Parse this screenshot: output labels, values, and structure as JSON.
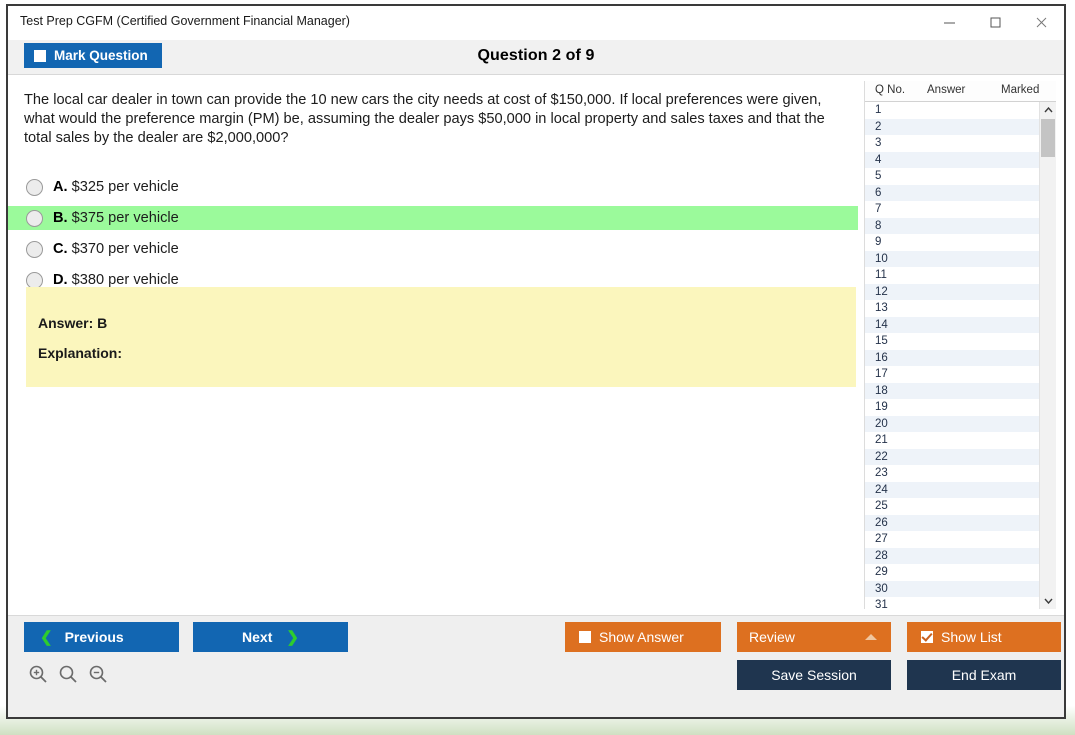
{
  "window": {
    "title": "Test Prep CGFM (Certified Government Financial Manager)",
    "minimize_label": "minimize",
    "maximize_label": "maximize",
    "close_label": "close"
  },
  "header": {
    "mark_question_label": "Mark Question",
    "mark_question_checked": false,
    "question_title": "Question 2 of 9"
  },
  "question": {
    "text": "The local car dealer in town can provide the 10 new cars the city needs at cost of $150,000. If local preferences were given, what would the preference margin (PM) be, assuming the dealer pays $50,000 in local property and sales taxes and that the total sales by the dealer are $2,000,000?",
    "options": [
      {
        "letter": "A.",
        "text": "$325 per vehicle",
        "selected": false,
        "highlighted": false
      },
      {
        "letter": "B.",
        "text": "$375 per vehicle",
        "selected": false,
        "highlighted": true
      },
      {
        "letter": "C.",
        "text": "$370 per vehicle",
        "selected": false,
        "highlighted": false
      },
      {
        "letter": "D.",
        "text": "$380 per vehicle",
        "selected": false,
        "highlighted": false
      }
    ]
  },
  "answer_panel": {
    "answer_label": "Answer: B",
    "explanation_label": "Explanation:"
  },
  "question_list": {
    "columns": [
      "Q No.",
      "Answer",
      "Marked"
    ],
    "rows": [
      {
        "no": "1",
        "answer": "",
        "marked": ""
      },
      {
        "no": "2",
        "answer": "",
        "marked": ""
      },
      {
        "no": "3",
        "answer": "",
        "marked": ""
      },
      {
        "no": "4",
        "answer": "",
        "marked": ""
      },
      {
        "no": "5",
        "answer": "",
        "marked": ""
      },
      {
        "no": "6",
        "answer": "",
        "marked": ""
      },
      {
        "no": "7",
        "answer": "",
        "marked": ""
      },
      {
        "no": "8",
        "answer": "",
        "marked": ""
      },
      {
        "no": "9",
        "answer": "",
        "marked": ""
      },
      {
        "no": "10",
        "answer": "",
        "marked": ""
      },
      {
        "no": "11",
        "answer": "",
        "marked": ""
      },
      {
        "no": "12",
        "answer": "",
        "marked": ""
      },
      {
        "no": "13",
        "answer": "",
        "marked": ""
      },
      {
        "no": "14",
        "answer": "",
        "marked": ""
      },
      {
        "no": "15",
        "answer": "",
        "marked": ""
      },
      {
        "no": "16",
        "answer": "",
        "marked": ""
      },
      {
        "no": "17",
        "answer": "",
        "marked": ""
      },
      {
        "no": "18",
        "answer": "",
        "marked": ""
      },
      {
        "no": "19",
        "answer": "",
        "marked": ""
      },
      {
        "no": "20",
        "answer": "",
        "marked": ""
      },
      {
        "no": "21",
        "answer": "",
        "marked": ""
      },
      {
        "no": "22",
        "answer": "",
        "marked": ""
      },
      {
        "no": "23",
        "answer": "",
        "marked": ""
      },
      {
        "no": "24",
        "answer": "",
        "marked": ""
      },
      {
        "no": "25",
        "answer": "",
        "marked": ""
      },
      {
        "no": "26",
        "answer": "",
        "marked": ""
      },
      {
        "no": "27",
        "answer": "",
        "marked": ""
      },
      {
        "no": "28",
        "answer": "",
        "marked": ""
      },
      {
        "no": "29",
        "answer": "",
        "marked": ""
      },
      {
        "no": "30",
        "answer": "",
        "marked": ""
      },
      {
        "no": "31",
        "answer": "",
        "marked": ""
      }
    ]
  },
  "footer": {
    "previous_label": "Previous",
    "next_label": "Next",
    "show_answer_label": "Show Answer",
    "show_answer_checked": false,
    "review_label": "Review",
    "show_list_label": "Show List",
    "show_list_checked": true,
    "save_session_label": "Save Session",
    "end_exam_label": "End Exam"
  },
  "colors": {
    "primary_blue": "#1266b2",
    "orange": "#dd7020",
    "navy": "#1f354f",
    "correct_green": "#9bfa9b",
    "answer_yellow": "#fbf6bd"
  }
}
